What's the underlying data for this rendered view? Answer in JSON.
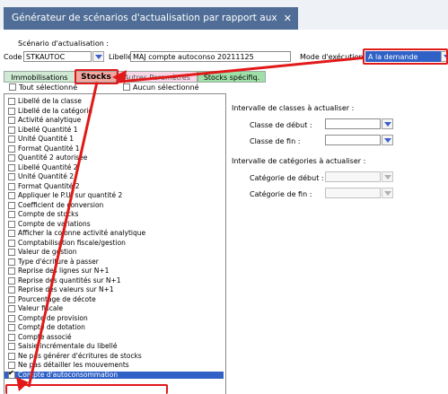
{
  "window": {
    "title": "Générateur de scénarios d'actualisation par rapport aux étalons",
    "close": "✕"
  },
  "scenario": {
    "section_label": "Scénario d'actualisation :",
    "code_label": "Code",
    "code_value": "STKAUTOC",
    "libelle_label": "Libellé",
    "libelle_value": "MAJ compte autoconso 20211125",
    "mode_label": "Mode d'exécution",
    "mode_value": "A la demande"
  },
  "tabs": [
    {
      "label": "Immobilisations"
    },
    {
      "label": "Stocks"
    },
    {
      "label": "Autres Paramètres"
    },
    {
      "label": "Stocks spécifiq."
    }
  ],
  "select_all": {
    "all_label": "Tout sélectionné",
    "none_label": "Aucun sélectionné"
  },
  "fields": [
    "Libellé de la classe",
    "Libellé de la catégorie",
    "Activité analytique",
    "Libellé Quantité 1",
    "Unité Quantité 1",
    "Format Quantité 1",
    "Quantité 2 autorisée",
    "Libellé Quantité 2",
    "Unité Quantité 2",
    "Format Quantité 2",
    "Appliquer le P.U. sur quantité 2",
    "Coefficient de conversion",
    "Compte de stocks",
    "Compte de variations",
    "Afficher la colonne activité analytique",
    "Comptabilisation fiscale/gestion",
    "Valeur de gestion",
    "Type d'écriture à passer",
    "Reprise des lignes sur N+1",
    "Reprise des quantités sur N+1",
    "Reprise des valeurs sur N+1",
    "Pourcentage de décote",
    "Valeur fiscale",
    "Compte de provision",
    "Compte de dotation",
    "Compte associé",
    "Saisie incrémentale du libellé",
    "Ne pas générer d'écritures de stocks",
    "Ne pas détailler les mouvements",
    "Compte d'autoconsommation"
  ],
  "classes": {
    "section_label": "Intervalle de classes à actualiser :",
    "start_label": "Classe de début :",
    "end_label": "Classe de fin :"
  },
  "categories": {
    "section_label": "Intervalle de catégories à actualiser :",
    "start_label": "Catégorie de début :",
    "end_label": "Catégorie de fin :"
  },
  "colors": {
    "title_bg": "#4f6d96",
    "selection": "#2f61c6",
    "annotation_red": "#e11919",
    "stocks_tab": "#f2a7a0",
    "green_tab": "#9fe0a8"
  }
}
